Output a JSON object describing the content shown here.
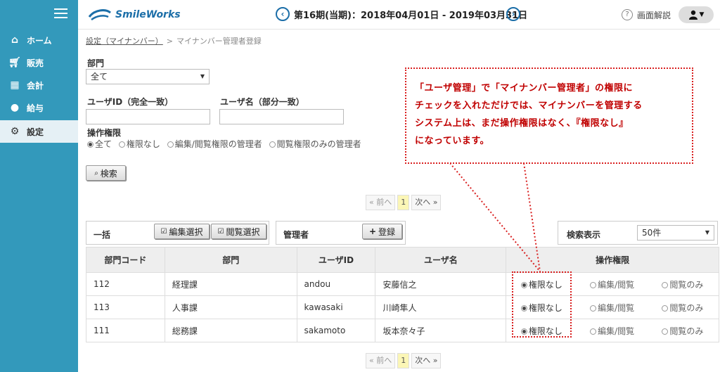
{
  "header": {
    "brand": "SmileWorks",
    "period_text": "第16期(当期)：2018年04月01日 - 2019年03月31日",
    "help_label": "画面解説"
  },
  "sidebar": {
    "items": [
      {
        "label": "ホーム",
        "icon": "home-icon"
      },
      {
        "label": "販売",
        "icon": "cart-icon"
      },
      {
        "label": "会計",
        "icon": "calculator-icon"
      },
      {
        "label": "給与",
        "icon": "moneybag-icon"
      },
      {
        "label": "設定",
        "icon": "gear-icon",
        "active": true
      }
    ]
  },
  "breadcrumb": {
    "link": "設定（マイナンバー）",
    "separator": ">",
    "current": "マイナンバー管理者登録"
  },
  "filters": {
    "dept_label": "部門",
    "dept_value": "全て",
    "userid_label": "ユーザID（完全一致）",
    "username_label": "ユーザ名（部分一致）",
    "perm_label": "操作権限",
    "perm_options": [
      "全て",
      "権限なし",
      "編集/閲覧権限の管理者",
      "閲覧権限のみの管理者"
    ],
    "search_button": "検索"
  },
  "pager": {
    "prev": "« 前へ",
    "current": "1",
    "next": "次へ »"
  },
  "toolbar": {
    "bulk_label": "一括",
    "edit_select": "編集選択",
    "view_select": "閲覧選択",
    "admin_label": "管理者",
    "register": "登録",
    "display_label": "検索表示",
    "display_value": "50件"
  },
  "table": {
    "headers": [
      "部門コード",
      "部門",
      "ユーザID",
      "ユーザ名",
      "操作権限"
    ],
    "perm_options": [
      "権限なし",
      "編集/閲覧",
      "閲覧のみ"
    ],
    "rows": [
      {
        "code": "112",
        "dept": "経理課",
        "userid": "andou",
        "username": "安藤信之",
        "perm": "権限なし"
      },
      {
        "code": "113",
        "dept": "人事課",
        "userid": "kawasaki",
        "username": "川崎隼人",
        "perm": "権限なし"
      },
      {
        "code": "111",
        "dept": "総務課",
        "userid": "sakamoto",
        "username": "坂本奈々子",
        "perm": "権限なし"
      }
    ]
  },
  "annotation": {
    "lines": [
      "「ユーザ管理」で「マイナンバー管理者」の権限に",
      "チェックを入れただけでは、マイナンバーを管理する",
      "システム上は、まだ操作権限はなく、『権限なし』",
      "になっています。"
    ],
    "color": "#c00000"
  }
}
